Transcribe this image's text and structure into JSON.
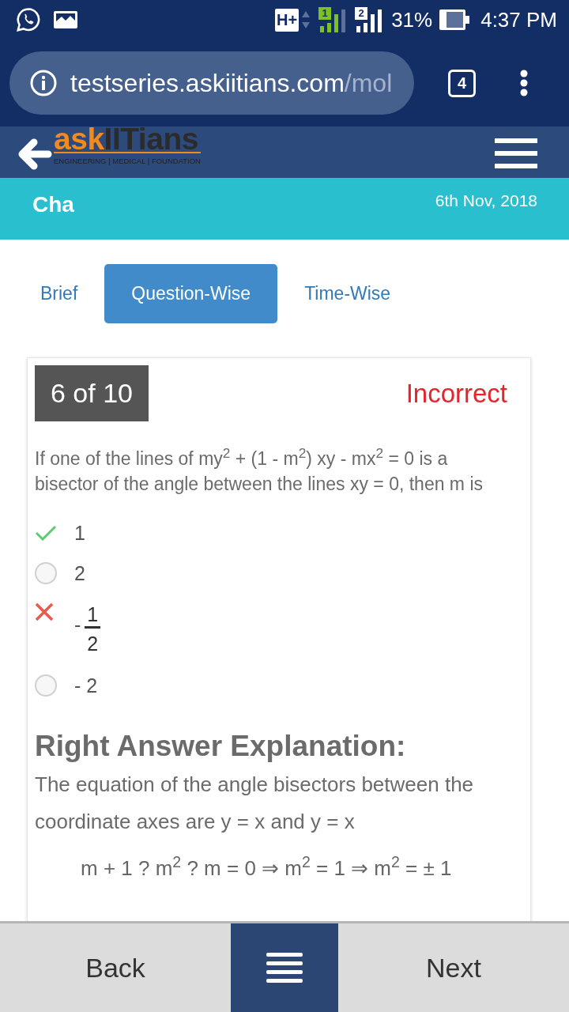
{
  "status_bar": {
    "network": "H+",
    "sim_1": "1",
    "sim_2": "2",
    "battery": "31%",
    "time": "4:37 PM"
  },
  "browser": {
    "url_host": "testseries.askiitians.com",
    "url_path": "/mol",
    "tab_count": "4"
  },
  "header": {
    "logo_accent": "ask",
    "logo_main": "IITians",
    "tagline": "ENGINEERING | MEDICAL | FOUNDATION"
  },
  "banner": {
    "title": "Cha",
    "date": "6th Nov, 2018"
  },
  "tabs": [
    {
      "label": "Brief",
      "selected": false
    },
    {
      "label": "Question-Wise",
      "selected": true
    },
    {
      "label": "Time-Wise",
      "selected": false
    }
  ],
  "question": {
    "counter": "6 of 10",
    "result": "Incorrect",
    "text": "If one of the lines of my$^{2}$ + (1 - m$^{2}$) xy - mx$^{2}$ = 0 is a bisector of the angle between the lines xy = 0, then m is",
    "options": [
      {
        "kind": "plain",
        "text": "1",
        "correct": true,
        "selected": false
      },
      {
        "kind": "plain",
        "text": "2",
        "correct": false,
        "selected": false
      },
      {
        "kind": "fraction",
        "sign": "-",
        "numerator": "1",
        "denominator": "2",
        "correct": false,
        "selected": true
      },
      {
        "kind": "plain",
        "text": "- 2",
        "correct": false,
        "selected": false
      }
    ]
  },
  "explanation": {
    "heading": "Right Answer Explanation:",
    "text": "The equation of the angle bisectors between the coordinate axes are y = x and y = x",
    "equation": "m + 1 ? m$^{2}$ ? m = 0 ⇒ m$^{2}$ = 1 ⇒ m$^{2}$ = ± 1"
  },
  "bottom_nav": {
    "back": "Back",
    "next": "Next"
  }
}
